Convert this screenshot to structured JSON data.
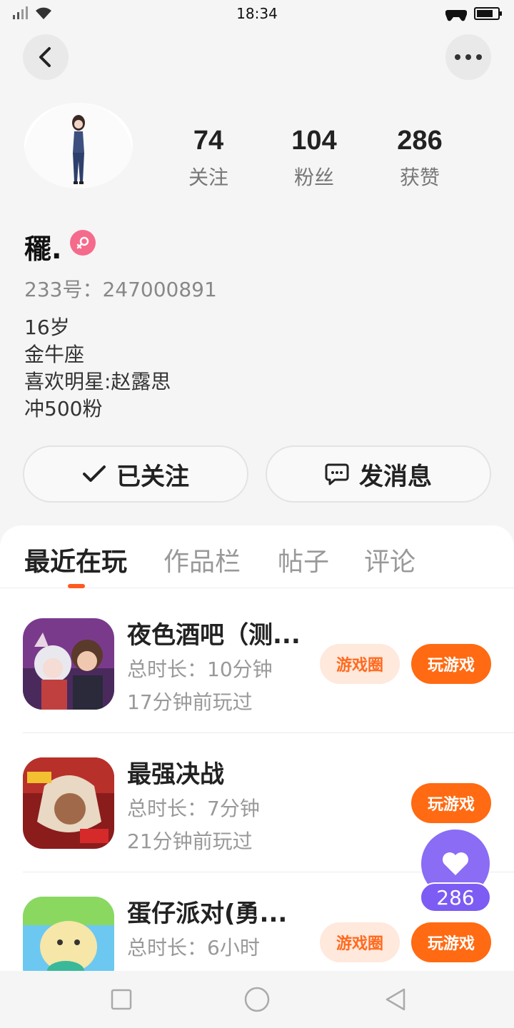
{
  "status": {
    "time": "18:34"
  },
  "profile": {
    "stats": [
      {
        "value": "74",
        "label": "关注"
      },
      {
        "value": "104",
        "label": "粉丝"
      },
      {
        "value": "286",
        "label": "获赞"
      }
    ],
    "username": "䆉.",
    "id_line": "233号：247000891",
    "bio": [
      "16岁",
      "金牛座",
      "喜欢明星:赵露思",
      "冲500粉"
    ]
  },
  "actions": {
    "follow_label": "已关注",
    "message_label": "发消息"
  },
  "tabs": [
    {
      "label": "最近在玩",
      "active": true
    },
    {
      "label": "作品栏",
      "active": false
    },
    {
      "label": "帖子",
      "active": false
    },
    {
      "label": "评论",
      "active": false
    }
  ],
  "games": [
    {
      "name": "夜色酒吧（测...",
      "duration": "总时长：10分钟",
      "last_played": "17分钟前玩过",
      "circle_label": "游戏圈",
      "play_label": "玩游戏"
    },
    {
      "name": "最强决战",
      "duration": "总时长：7分钟",
      "last_played": "21分钟前玩过",
      "play_label": "玩游戏"
    },
    {
      "name": "蛋仔派对(勇...",
      "duration": "总时长：6小时",
      "circle_label": "游戏圈",
      "play_label": "玩游戏"
    }
  ],
  "likes": {
    "count": "286"
  },
  "icons": {
    "back": "chevron-left-icon",
    "more": "more-dots-icon",
    "gender": "female-icon",
    "check": "check-icon",
    "message": "chat-bubble-icon",
    "heart": "heart-icon"
  },
  "colors": {
    "accent": "#ff6a12",
    "like": "#8a6cf5",
    "gender": "#f56b8c"
  }
}
